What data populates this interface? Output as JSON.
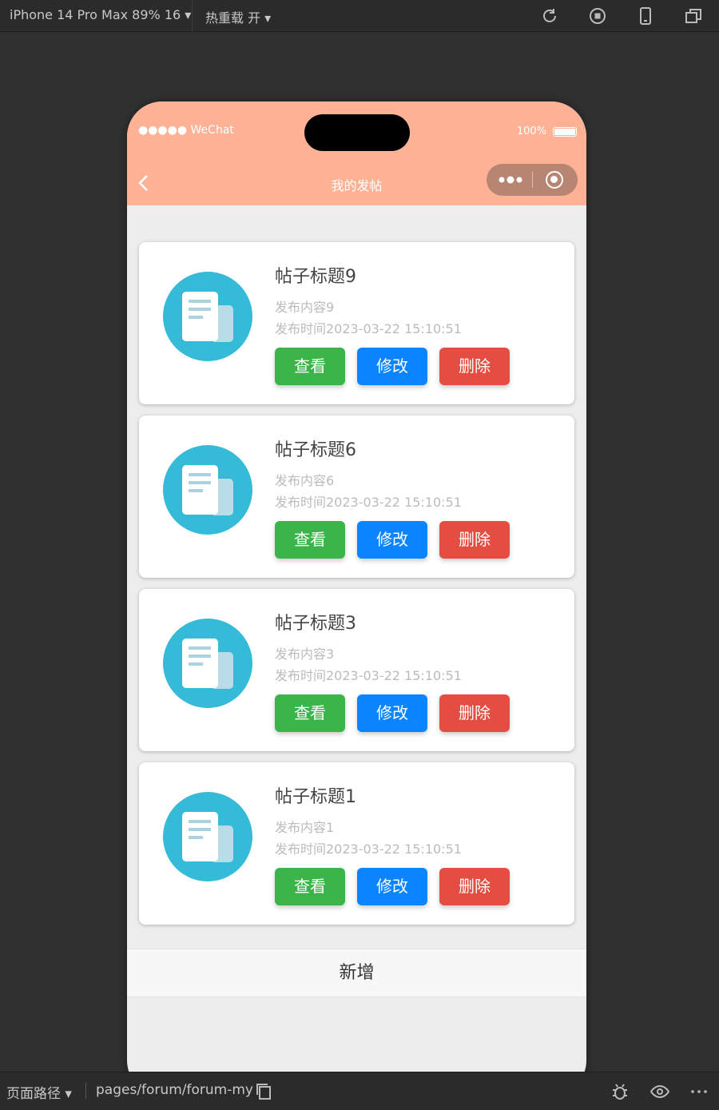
{
  "devtools": {
    "device_label": "iPhone 14 Pro Max 89% 16",
    "hot_reload_label": "热重载 开",
    "page_path_label": "页面路径",
    "page_path": "pages/forum/forum-my"
  },
  "status_bar": {
    "carrier": "●●●●● WeChat",
    "battery_text": "100%"
  },
  "nav": {
    "title": "我的发帖"
  },
  "posts": [
    {
      "title": "帖子标题9",
      "content": "发布内容9",
      "time": "发布时间2023-03-22 15:10:51"
    },
    {
      "title": "帖子标题6",
      "content": "发布内容6",
      "time": "发布时间2023-03-22 15:10:51"
    },
    {
      "title": "帖子标题3",
      "content": "发布内容3",
      "time": "发布时间2023-03-22 15:10:51"
    },
    {
      "title": "帖子标题1",
      "content": "发布内容1",
      "time": "发布时间2023-03-22 15:10:51"
    }
  ],
  "buttons": {
    "view": "查看",
    "edit": "修改",
    "delete": "删除",
    "add": "新增"
  },
  "colors": {
    "header": "#fdb296",
    "view_button": "#3ab54a",
    "edit_button": "#0a84ff",
    "delete_button": "#e54d42",
    "avatar": "#35bbd7"
  }
}
